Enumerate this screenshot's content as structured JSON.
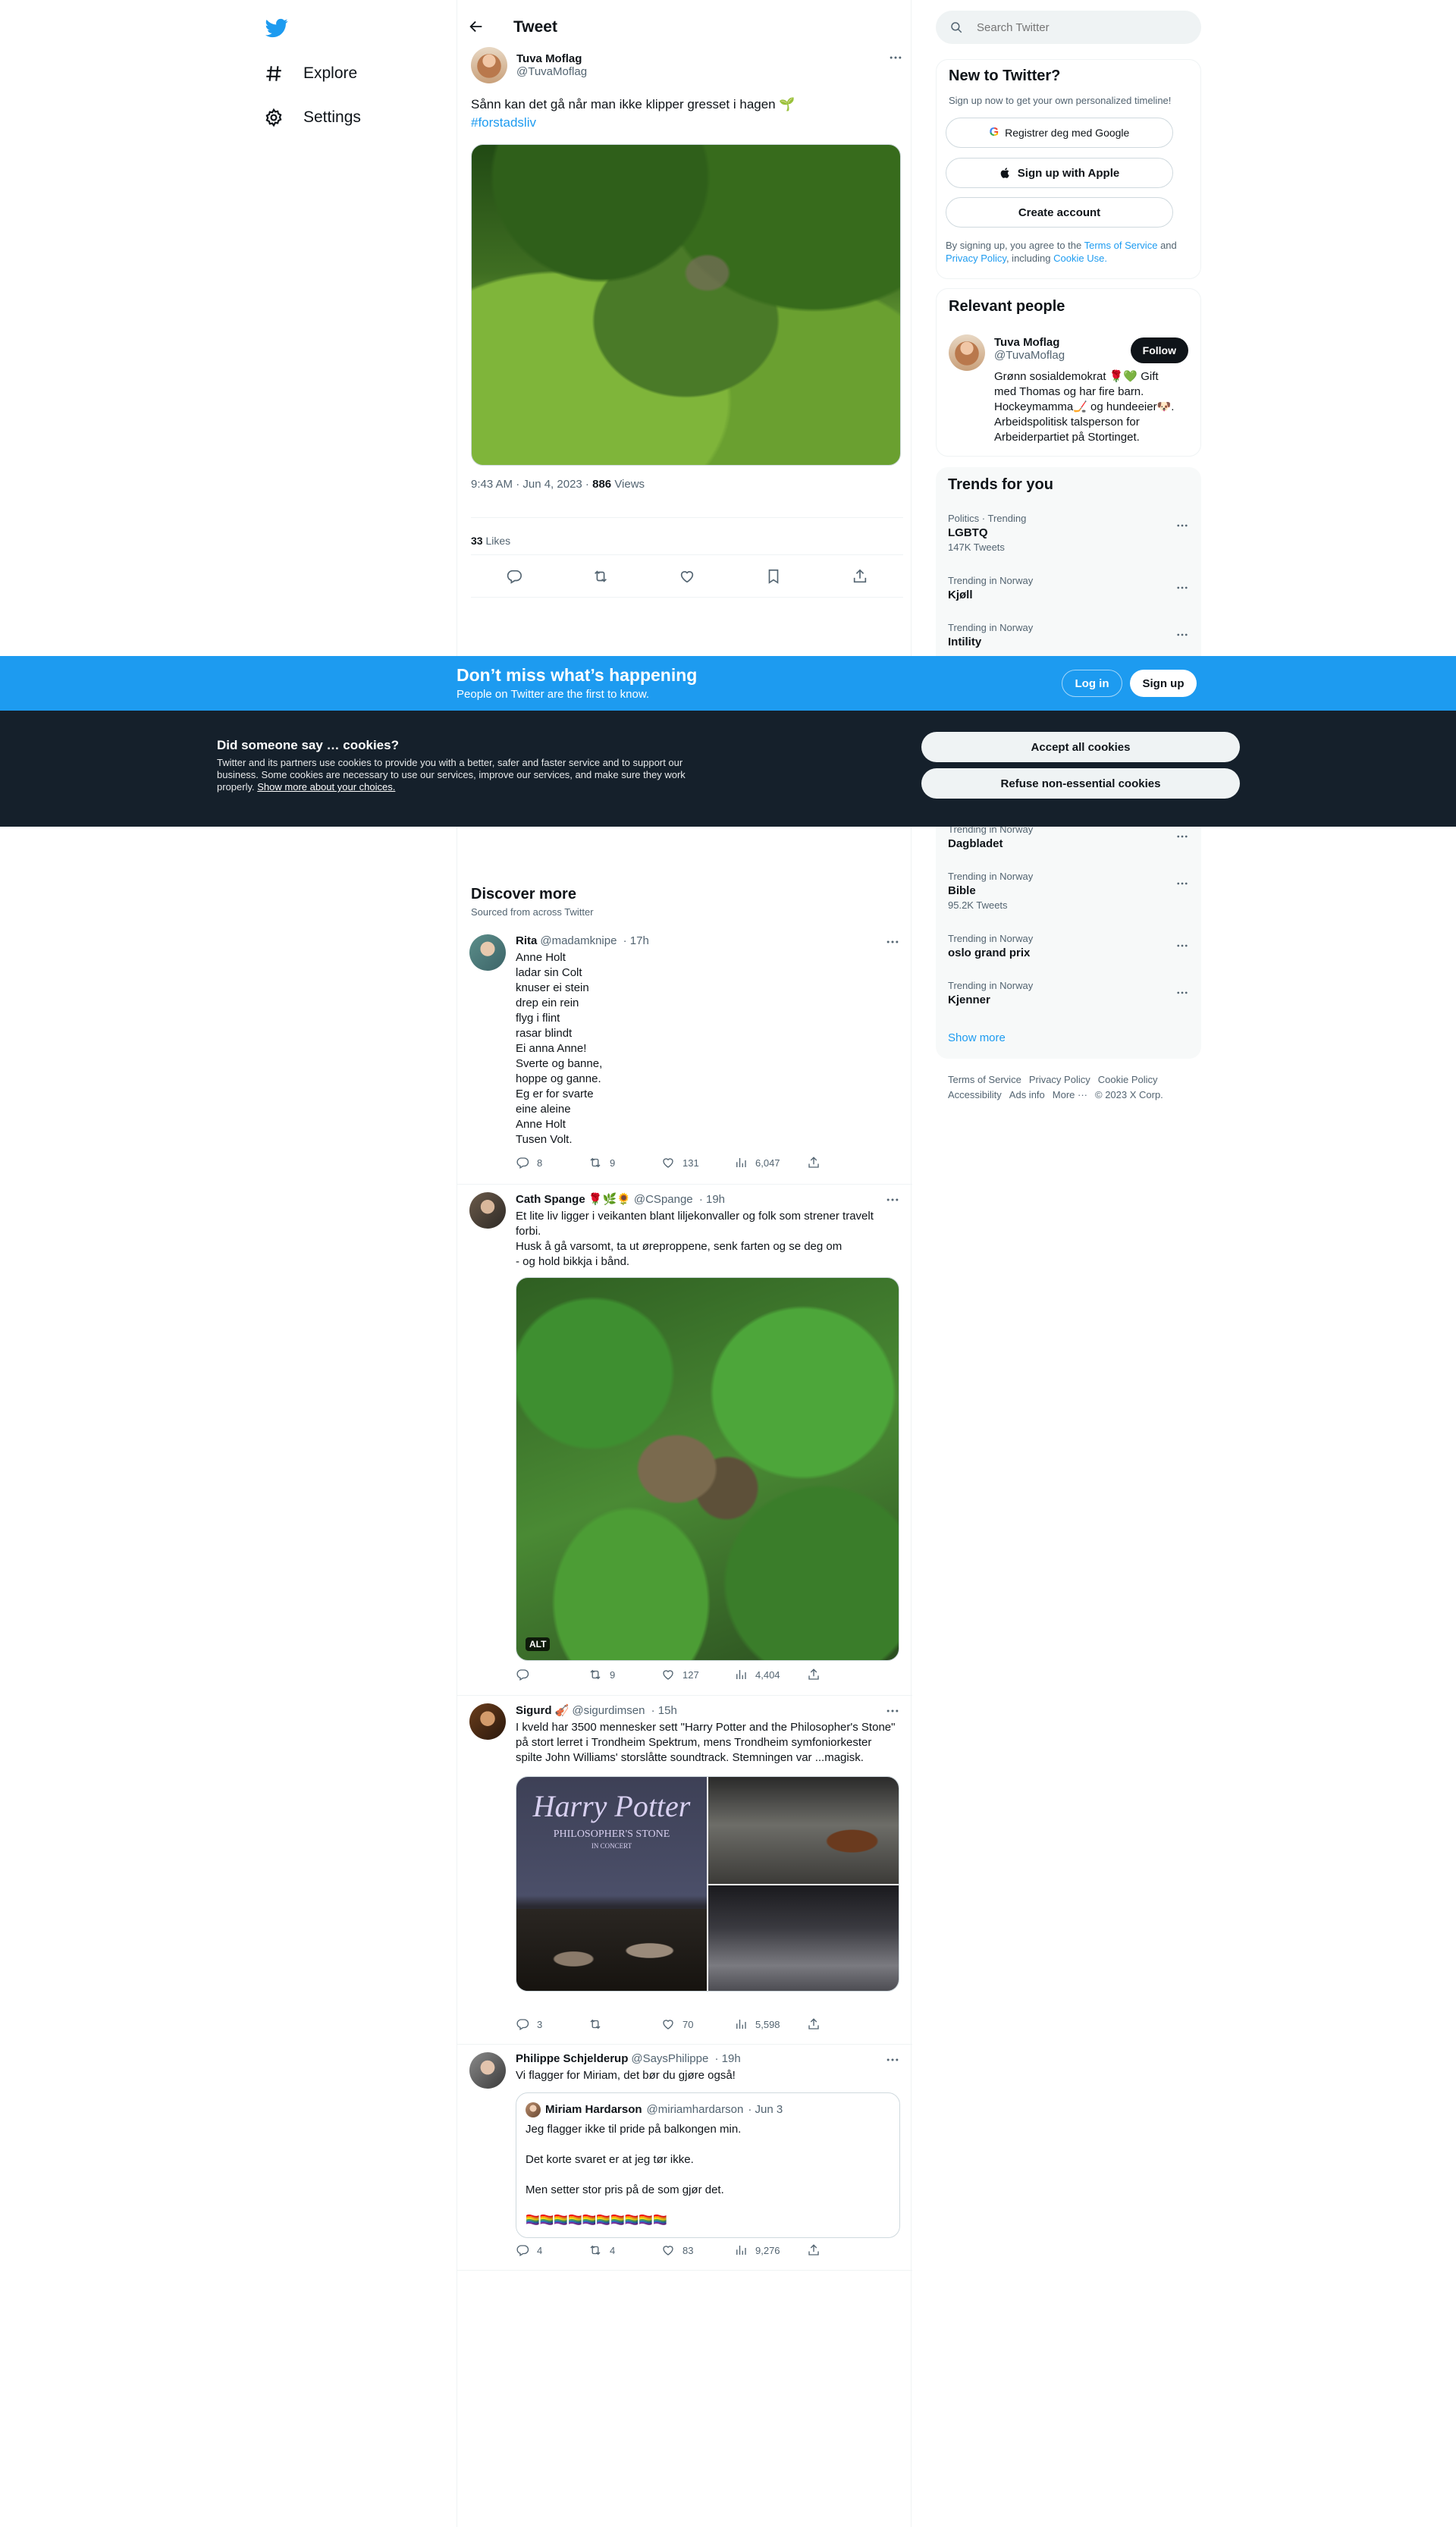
{
  "nav": {
    "explore": "Explore",
    "settings": "Settings"
  },
  "header": {
    "title": "Tweet"
  },
  "primary_tweet": {
    "name": "Tuva Moflag",
    "handle": "@TuvaMoflag",
    "text": "Sånn kan det gå når man ikke klipper gresset i hagen 🌱",
    "hashtag": "#forstadsliv",
    "time": "9:43 AM · Jun 4, 2023",
    "views_count": "886",
    "views_label": "Views",
    "likes_count": "33",
    "likes_label": "Likes"
  },
  "discover": {
    "title": "Discover more",
    "subtitle": "Sourced from across Twitter"
  },
  "tweets": [
    {
      "name": "Rita",
      "handle": "@madamknipe",
      "time": "· 17h",
      "text": "Anne Holt\nladar sin Colt\nknuser ei stein\ndrep ein rein\nflyg i flint\nrasar blindt\nEi anna Anne!\nSverte og banne,\nhoppe og ganne.\nEg er for svarte\neine aleine\nAnne Holt\nTusen Volt.",
      "replies": "8",
      "retweets": "9",
      "likes": "131",
      "views": "6,047"
    },
    {
      "name": "Cath Spange 🌹🌿🌻",
      "handle": "@CSpange",
      "time": "· 19h",
      "text": "Et lite liv ligger i veikanten blant liljekonvaller og folk som strener travelt forbi.\nHusk å gå varsomt, ta ut øreproppene, senk farten og se deg om\n- og hold bikkja i bånd.",
      "alt": "ALT",
      "replies": "",
      "retweets": "9",
      "likes": "127",
      "views": "4,404"
    },
    {
      "name": "Sigurd 🎻",
      "handle": "@sigurdimsen",
      "time": "· 15h",
      "text": "I kveld har 3500 mennesker sett \"Harry Potter and the Philosopher's Stone\" på stort lerret i Trondheim Spektrum, mens Trondheim symfoniorkester spilte John Williams' storslåtte soundtrack. Stemningen var ...magisk.",
      "poster_title": "Harry Potter",
      "poster_sub": "PHILOSOPHER'S STONE",
      "poster_tag": "IN CONCERT",
      "replies": "3",
      "retweets": "",
      "likes": "70",
      "views": "5,598"
    },
    {
      "name": "Philippe Schjelderup",
      "handle": "@SaysPhilippe",
      "time": "· 19h",
      "text": "Vi flagger for Miriam, det bør du gjøre også!",
      "quote": {
        "name": "Miriam Hardarson",
        "handle": "@miriamhardarson",
        "time": "· Jun 3",
        "text": "Jeg flagger ikke til pride på balkongen min.\n\nDet korte svaret er at jeg tør ikke.\n\nMen setter stor pris på de som gjør det.\n\n🏳️‍🌈🏳️‍🌈🏳️‍🌈🏳️‍🌈🏳️‍🌈🏳️‍🌈🏳️‍🌈🏳️‍🌈🏳️‍🌈🏳️‍🌈"
      },
      "replies": "4",
      "retweets": "4",
      "likes": "83",
      "views": "9,276"
    }
  ],
  "search": {
    "placeholder": "Search Twitter"
  },
  "new_to_twitter": {
    "title": "New to Twitter?",
    "subtitle": "Sign up now to get your own personalized timeline!",
    "google": "Registrer deg med Google",
    "apple": "Sign up with Apple",
    "create": "Create account",
    "legal_1": "By signing up, you agree to the",
    "terms": "Terms of Service",
    "legal_2": "and",
    "privacy": "Privacy Policy",
    "legal_3": ", including",
    "cookie_use": "Cookie Use."
  },
  "relevant": {
    "title": "Relevant people",
    "name": "Tuva Moflag",
    "handle": "@TuvaMoflag",
    "follow": "Follow",
    "bio": "Grønn sosialdemokrat 🌹💚 Gift med Thomas og har fire barn. Hockeymamma🏒 og hundeeier🐶. Arbeidspolitisk talsperson for Arbeiderpartiet på Stortinget."
  },
  "trends": {
    "title": "Trends for you",
    "items": [
      {
        "context": "Politics · Trending",
        "name": "LGBTQ",
        "count": "147K Tweets"
      },
      {
        "context": "Trending in Norway",
        "name": "Kjøll",
        "count": ""
      },
      {
        "context": "Trending in Norway",
        "name": "Intility",
        "count": ""
      },
      {
        "context": "Trending in Norway",
        "name": "Dagbladet",
        "count": ""
      },
      {
        "context": "Trending in Norway",
        "name": "Bible",
        "count": "95.2K Tweets"
      },
      {
        "context": "Trending in Norway",
        "name": "oslo grand prix",
        "count": ""
      },
      {
        "context": "Trending in Norway",
        "name": "Kjenner",
        "count": ""
      }
    ],
    "show_more": "Show more"
  },
  "footer": {
    "links": [
      "Terms of Service",
      "Privacy Policy",
      "Cookie Policy",
      "Accessibility",
      "Ads info",
      "More ···"
    ],
    "copyright": "© 2023 X Corp."
  },
  "banner": {
    "title": "Don’t miss what’s happening",
    "subtitle": "People on Twitter are the first to know.",
    "login": "Log in",
    "signup": "Sign up"
  },
  "cookies": {
    "title": "Did someone say … cookies?",
    "text": "Twitter and its partners use cookies to provide you with a better, safer and faster service and to support our business. Some cookies are necessary to use our services, improve our services, and make sure they work properly.",
    "link": "Show more about your choices.",
    "accept": "Accept all cookies",
    "refuse": "Refuse non-essential cookies"
  },
  "colors": {
    "accent": "#1d9bf0",
    "text": "#0f1419",
    "muted": "#536471",
    "cookie_bg": "#15202b"
  }
}
